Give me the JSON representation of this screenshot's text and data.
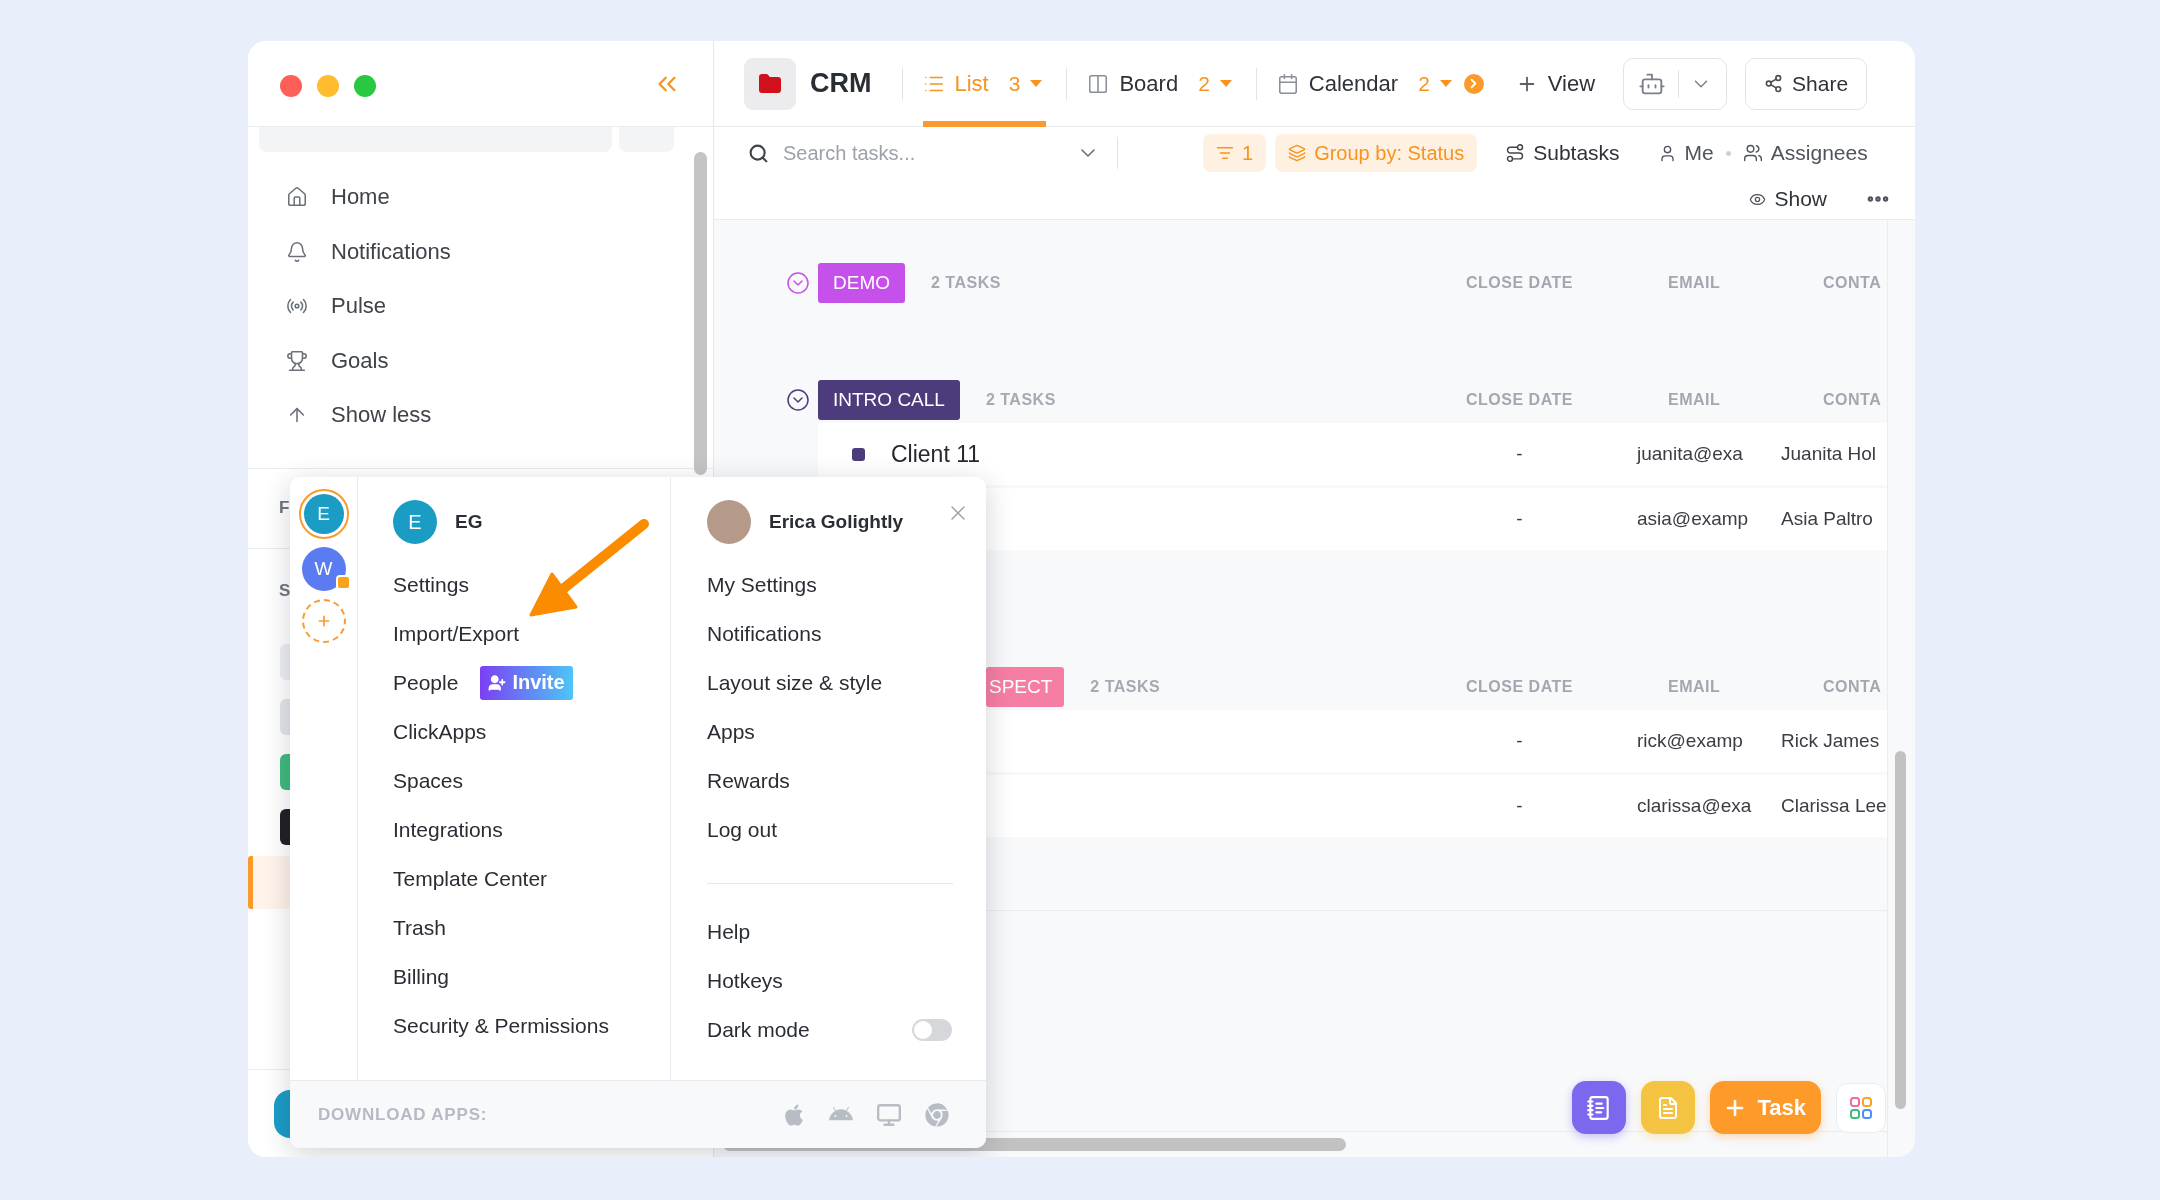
{
  "sidebar": {
    "nav": [
      {
        "label": "Home"
      },
      {
        "label": "Notifications"
      },
      {
        "label": "Pulse"
      },
      {
        "label": "Goals"
      },
      {
        "label": "Show less"
      }
    ],
    "headings": [
      "F",
      "S"
    ],
    "spaces": [
      {
        "color": "#eceef2",
        "selected": false
      },
      {
        "color": "#e3e5ea",
        "selected": false
      },
      {
        "color": "#3fba7e",
        "selected": false
      },
      {
        "color": "#1f2023",
        "selected": false
      },
      {
        "selected": true
      }
    ]
  },
  "header": {
    "title": "CRM",
    "tabs": [
      {
        "label": "List",
        "count": "3",
        "selected": true
      },
      {
        "label": "Board",
        "count": "2",
        "selected": false
      },
      {
        "label": "Calendar",
        "count": "2",
        "selected": false
      }
    ],
    "add_view": "View",
    "share": "Share"
  },
  "toolbar": {
    "search": {
      "placeholder": "Search tasks..."
    },
    "filter_count": "1",
    "group_by": "Group by: Status",
    "subtasks": "Subtasks",
    "me": "Me",
    "assignees": "Assignees",
    "show": "Show"
  },
  "groups": [
    {
      "kind": "open",
      "label": "DEMO",
      "color": "#c650ea",
      "count": "2 TASKS",
      "columns": [
        "CLOSE DATE",
        "EMAIL",
        "CONTA"
      ]
    },
    {
      "kind": "open",
      "label": "INTRO CALL",
      "color": "#4d3c7c",
      "count": "2 TASKS",
      "columns": [
        "CLOSE DATE",
        "EMAIL",
        "CONTA"
      ],
      "rows": [
        {
          "name": "Client 11",
          "close_date": "-",
          "email": "juanita@exa",
          "contact": "Juanita Hol"
        },
        {
          "close_date": "-",
          "email": "asia@examp",
          "contact": "Asia Paltro"
        }
      ]
    },
    {
      "kind": "covered",
      "label": "SPECT",
      "color": "#f77ea3",
      "count": "2 TASKS",
      "columns": [
        "CLOSE DATE",
        "EMAIL",
        "CONTA"
      ],
      "rows": [
        {
          "close_date": "-",
          "email": "rick@examp",
          "contact": "Rick James"
        },
        {
          "close_date": "-",
          "email": "clarissa@exa",
          "contact": "Clarissa Lee"
        }
      ]
    }
  ],
  "popup": {
    "workspaces": [
      {
        "initial": "E",
        "color": "#1b9cc5",
        "selected": true,
        "badge": false
      },
      {
        "initial": "W",
        "color": "#5b7bf2",
        "selected": false,
        "badge": true
      }
    ],
    "workspace": {
      "initial": "E",
      "name": "EG"
    },
    "workspace_menu": [
      {
        "label": "Settings"
      },
      {
        "label": "Import/Export"
      },
      {
        "label": "People",
        "action": "Invite"
      },
      {
        "label": "ClickApps"
      },
      {
        "label": "Spaces"
      },
      {
        "label": "Integrations"
      },
      {
        "label": "Template Center"
      },
      {
        "label": "Trash"
      },
      {
        "label": "Billing"
      },
      {
        "label": "Security & Permissions"
      }
    ],
    "user": {
      "name": "Erica Golightly"
    },
    "user_menu": [
      "My Settings",
      "Notifications",
      "Layout size & style",
      "Apps",
      "Rewards",
      "Log out"
    ],
    "help_menu": [
      "Help",
      "Hotkeys"
    ],
    "dark_mode": {
      "label": "Dark mode",
      "on": false
    },
    "footer": "DOWNLOAD APPS:"
  },
  "floating": {
    "task": "Task"
  }
}
